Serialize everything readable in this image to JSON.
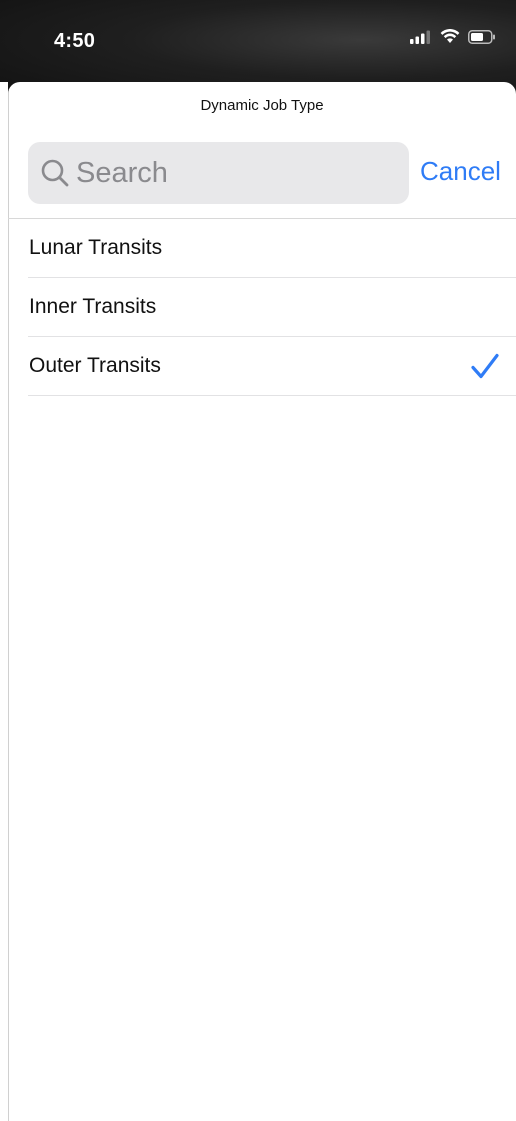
{
  "status_bar": {
    "time": "4:50",
    "icons": [
      "cellular-signal-icon",
      "wifi-icon",
      "battery-icon"
    ]
  },
  "sheet": {
    "title": "Dynamic Job Type",
    "search": {
      "placeholder": "Search",
      "value": ""
    },
    "cancel_label": "Cancel"
  },
  "options": [
    {
      "label": "Lunar Transits",
      "selected": false
    },
    {
      "label": "Inner Transits",
      "selected": false
    },
    {
      "label": "Outer Transits",
      "selected": true
    }
  ],
  "colors": {
    "accent": "#2f7cf6",
    "search_background": "#e8e8ea",
    "divider": "#e2e2e4"
  }
}
